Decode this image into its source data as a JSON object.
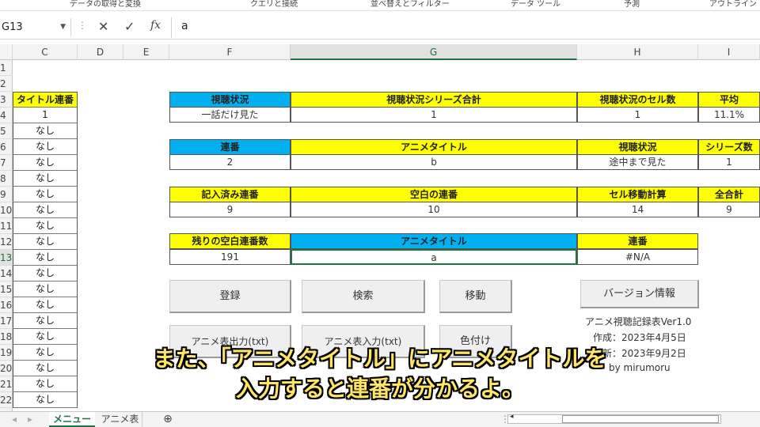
{
  "ribbon": {
    "items": [
      "データの取得と変換",
      "クエリと接続",
      "並べ替えとフィルター",
      "データ ツール",
      "予測",
      "アウトライン"
    ]
  },
  "formula_bar": {
    "name_box": "G13",
    "cancel_icon": "✕",
    "enter_icon": "✓",
    "fx": "fx",
    "value": "a"
  },
  "columns": [
    "C",
    "D",
    "E",
    "F",
    "G",
    "H",
    "I"
  ],
  "rows": [
    "1",
    "2",
    "3",
    "4",
    "5",
    "6",
    "7",
    "8",
    "9",
    "10",
    "11",
    "12",
    "13",
    "14",
    "15",
    "16",
    "17",
    "18",
    "19",
    "20",
    "21",
    "22"
  ],
  "col_c": {
    "header": "タイトル連番",
    "values": [
      "1",
      "なし",
      "なし",
      "なし",
      "なし",
      "なし",
      "なし",
      "なし",
      "なし",
      "なし",
      "なし",
      "なし",
      "なし",
      "なし",
      "なし",
      "なし",
      "なし",
      "なし",
      "なし"
    ]
  },
  "table1": {
    "headers": [
      "視聴状況",
      "視聴状況シリーズ合計",
      "視聴状況のセル数",
      "平均"
    ],
    "values": [
      "一話だけ見た",
      "1",
      "1",
      "11.1%"
    ]
  },
  "table2": {
    "headers": [
      "連番",
      "アニメタイトル",
      "視聴状況",
      "シリーズ数"
    ],
    "values": [
      "2",
      "b",
      "途中まで見た",
      "1"
    ]
  },
  "table3": {
    "headers": [
      "記入済み連番",
      "空白の連番",
      "セル移動計算",
      "全合計"
    ],
    "values": [
      "9",
      "10",
      "14",
      "9"
    ]
  },
  "table4": {
    "headers": [
      "残りの空白連番数",
      "アニメタイトル",
      "連番"
    ],
    "values": [
      "191",
      "a",
      "#N/A"
    ]
  },
  "buttons": {
    "register": "登録",
    "search": "検索",
    "move": "移動",
    "version": "バージョン情報",
    "export": "アニメ表出力(txt)",
    "import": "アニメ表入力(txt)",
    "color": "色付け"
  },
  "info": {
    "title": "アニメ視聴記録表Ver1.0",
    "created": "作成：2023年4月5日",
    "updated": "更新：2023年9月2日",
    "author": "by mirumoru"
  },
  "subtitle": {
    "line1": "また、「アニメタイトル」にアニメタイトルを",
    "line2": "入力すると連番が分かるよ。"
  },
  "sheet_tabs": {
    "menu": "メニュー",
    "anime": "アニメ表",
    "add": "⊕"
  },
  "colors": {
    "yellow": "#ffff00",
    "blue": "#00b0f0",
    "excel_green": "#217346"
  }
}
